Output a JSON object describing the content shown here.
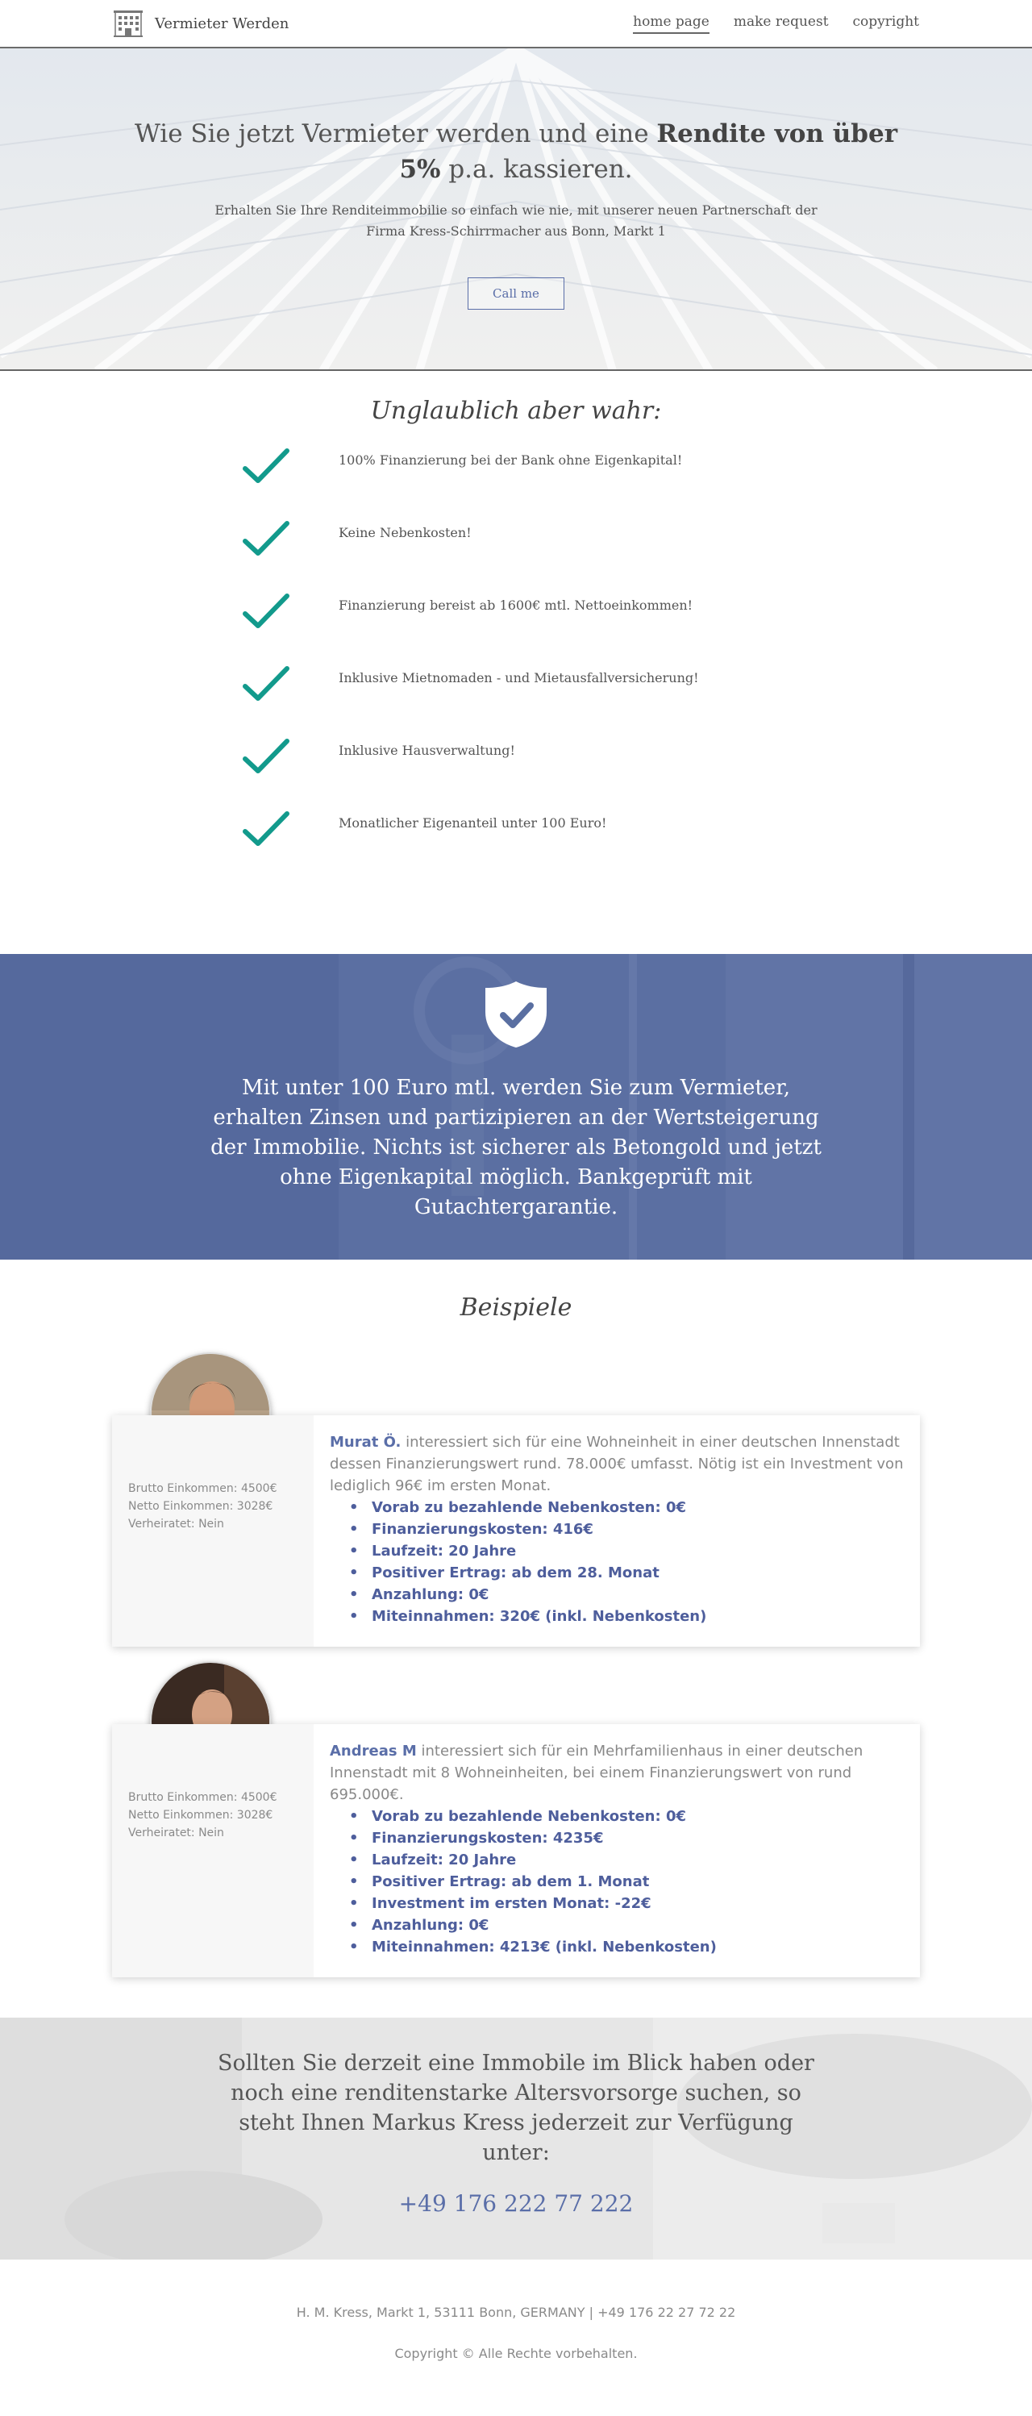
{
  "nav": {
    "brand": "Vermieter Werden",
    "links": [
      {
        "label": "home page"
      },
      {
        "label": "make request"
      },
      {
        "label": "copyright"
      }
    ]
  },
  "hero": {
    "title_part1": "Wie Sie jetzt Vermieter werden und eine ",
    "title_bold": "Rendite von über 5%",
    "title_part2": " p.a. kassieren.",
    "subtitle": "Erhalten Sie Ihre Renditeimmobilie so einfach wie nie, mit unserer neuen Partnerschaft der Firma Kress-Schirrmacher aus Bonn, Markt 1",
    "button": "Call me"
  },
  "benefits": {
    "title": "Unglaublich aber wahr:",
    "items": [
      "100% Finanzierung bei der Bank ohne Eigenkapital!",
      "Keine Nebenkosten!",
      "Finanzierung bereist ab 1600€ mtl. Nettoeinkommen!",
      "Inklusive Mietnomaden - und Mietausfallversicherung!",
      "Inklusive Hausverwaltung!",
      "Monatlicher Eigenanteil unter 100 Euro!"
    ],
    "check_color": "#129a8c"
  },
  "banner": {
    "text": "Mit unter 100 Euro mtl. werden Sie zum Vermieter, erhalten Zinsen und partizipieren an der Wertsteigerung der Immobilie. Nichts ist sicherer als Betongold und jetzt ohne Eigenkapital möglich. Bankgeprüft mit Gutachtergarantie.",
    "icon": "shield-check-icon",
    "color": "#5a6fa1"
  },
  "examples": {
    "title": "Beispiele",
    "cards": [
      {
        "stats": [
          "Brutto Einkommen: 4500€",
          "Netto Einkommen: 3028€",
          "Verheiratet: Nein"
        ],
        "name": "Murat Ö.",
        "description": " interessiert sich für eine Wohneinheit in einer deutschen Innenstadt dessen Finanzierungswert rund. 78.000€ umfasst. Nötig ist ein Investment von lediglich 96€ im ersten Monat.",
        "bullets": [
          "Vorab zu bezahlende Nebenkosten: 0€",
          "Finanzierungskosten: 416€",
          "Laufzeit: 20 Jahre",
          "Positiver Ertrag: ab dem 28. Monat",
          "Anzahlung: 0€",
          "Miteinnahmen: 320€ (inkl. Nebenkosten)"
        ]
      },
      {
        "stats": [
          "Brutto Einkommen: 4500€",
          "Netto Einkommen: 3028€",
          "Verheiratet: Nein"
        ],
        "name": "Andreas M",
        "description": " interessiert sich für ein Mehrfamilienhaus in einer deutschen Innenstadt mit 8 Wohneinheiten, bei einem Finanzierungswert von rund 695.000€.",
        "bullets": [
          "Vorab zu bezahlende Nebenkosten: 0€",
          "Finanzierungskosten: 4235€",
          "Laufzeit: 20 Jahre",
          "Positiver Ertrag: ab dem 1. Monat",
          "Investment im ersten Monat: -22€",
          "Anzahlung: 0€",
          "Miteinnahmen: 4213€ (inkl. Nebenkosten)"
        ]
      }
    ]
  },
  "contact": {
    "text": "Sollten Sie derzeit eine Immobile im Blick haben oder noch eine renditenstarke Altersvorsorge suchen, so steht Ihnen Markus Kress jederzeit zur Verfügung unter:",
    "phone": "+49 176 222 77 222"
  },
  "footer": {
    "address": "H. M. Kress, Markt 1, 53111 Bonn, GERMANY |  +49 176 22 27 72 22",
    "copyright": "Copyright © Alle Rechte vorbehalten."
  }
}
